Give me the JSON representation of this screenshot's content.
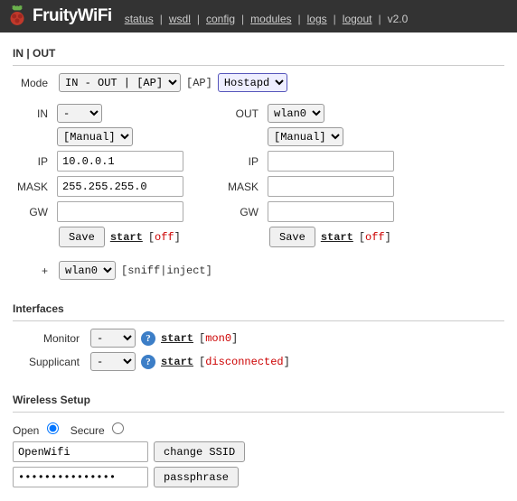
{
  "header": {
    "brand": "FruityWiFi",
    "nav": [
      "status",
      "wsdl",
      "config",
      "modules",
      "logs",
      "logout"
    ],
    "version": "v2.0"
  },
  "section_inout": {
    "title": "IN | OUT",
    "mode_label": "Mode",
    "mode_value": "IN - OUT | [AP]",
    "ap_label": "[AP]",
    "ap_value": "Hostapd",
    "in": {
      "iface_label": "IN",
      "iface_value": "-",
      "manual": "[Manual]",
      "ip_label": "IP",
      "ip_value": "10.0.0.1",
      "mask_label": "MASK",
      "mask_value": "255.255.255.0",
      "gw_label": "GW",
      "gw_value": ""
    },
    "out": {
      "iface_label": "OUT",
      "iface_value": "wlan0",
      "manual": "[Manual]",
      "ip_label": "IP",
      "ip_value": "",
      "mask_label": "MASK",
      "mask_value": "",
      "gw_label": "GW",
      "gw_value": ""
    },
    "save_label": "Save",
    "start_label": "start",
    "status": "off",
    "plus_label": "+",
    "plus_value": "wlan0",
    "plus_desc": "[sniff|inject]"
  },
  "section_ifaces": {
    "title": "Interfaces",
    "monitor_label": "Monitor",
    "monitor_value": "-",
    "monitor_status": "mon0",
    "supplicant_label": "Supplicant",
    "supplicant_value": "-",
    "supplicant_status": "disconnected",
    "start_label": "start"
  },
  "section_wireless": {
    "title": "Wireless Setup",
    "open_label": "Open",
    "secure_label": "Secure",
    "ssid_value": "OpenWifi",
    "change_ssid_label": "change SSID",
    "pass_value": "",
    "pass_placeholder": "",
    "passphrase_label": "passphrase"
  }
}
